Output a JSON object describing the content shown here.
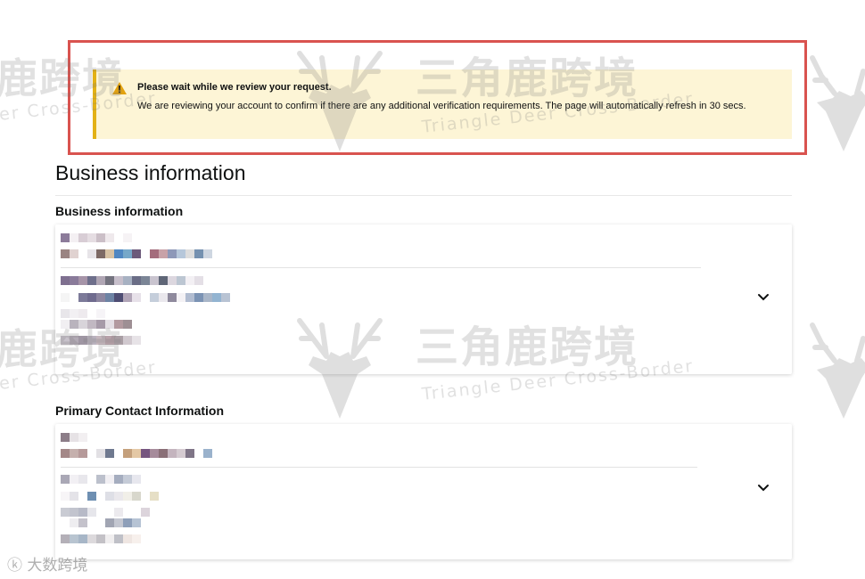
{
  "alert": {
    "title": "Please wait while we review your request.",
    "message": "We are reviewing your account to confirm if there are any additional verification requirements. The page will automatically refresh in 30 secs."
  },
  "page": {
    "title": "Business information"
  },
  "sections": [
    {
      "title": "Business information"
    },
    {
      "title": "Primary Contact Information"
    }
  ],
  "watermark": {
    "brand_cn": "三角鹿跨境",
    "partial_cn": "鹿跨境",
    "brand_en": "Triangle Deer Cross-Border",
    "partial_en": "er Cross-Border",
    "corner": "大数跨境"
  },
  "colors": {
    "alert_bg": "#fdf5d6",
    "alert_bar": "#e3b115",
    "highlight": "#d9534f"
  }
}
